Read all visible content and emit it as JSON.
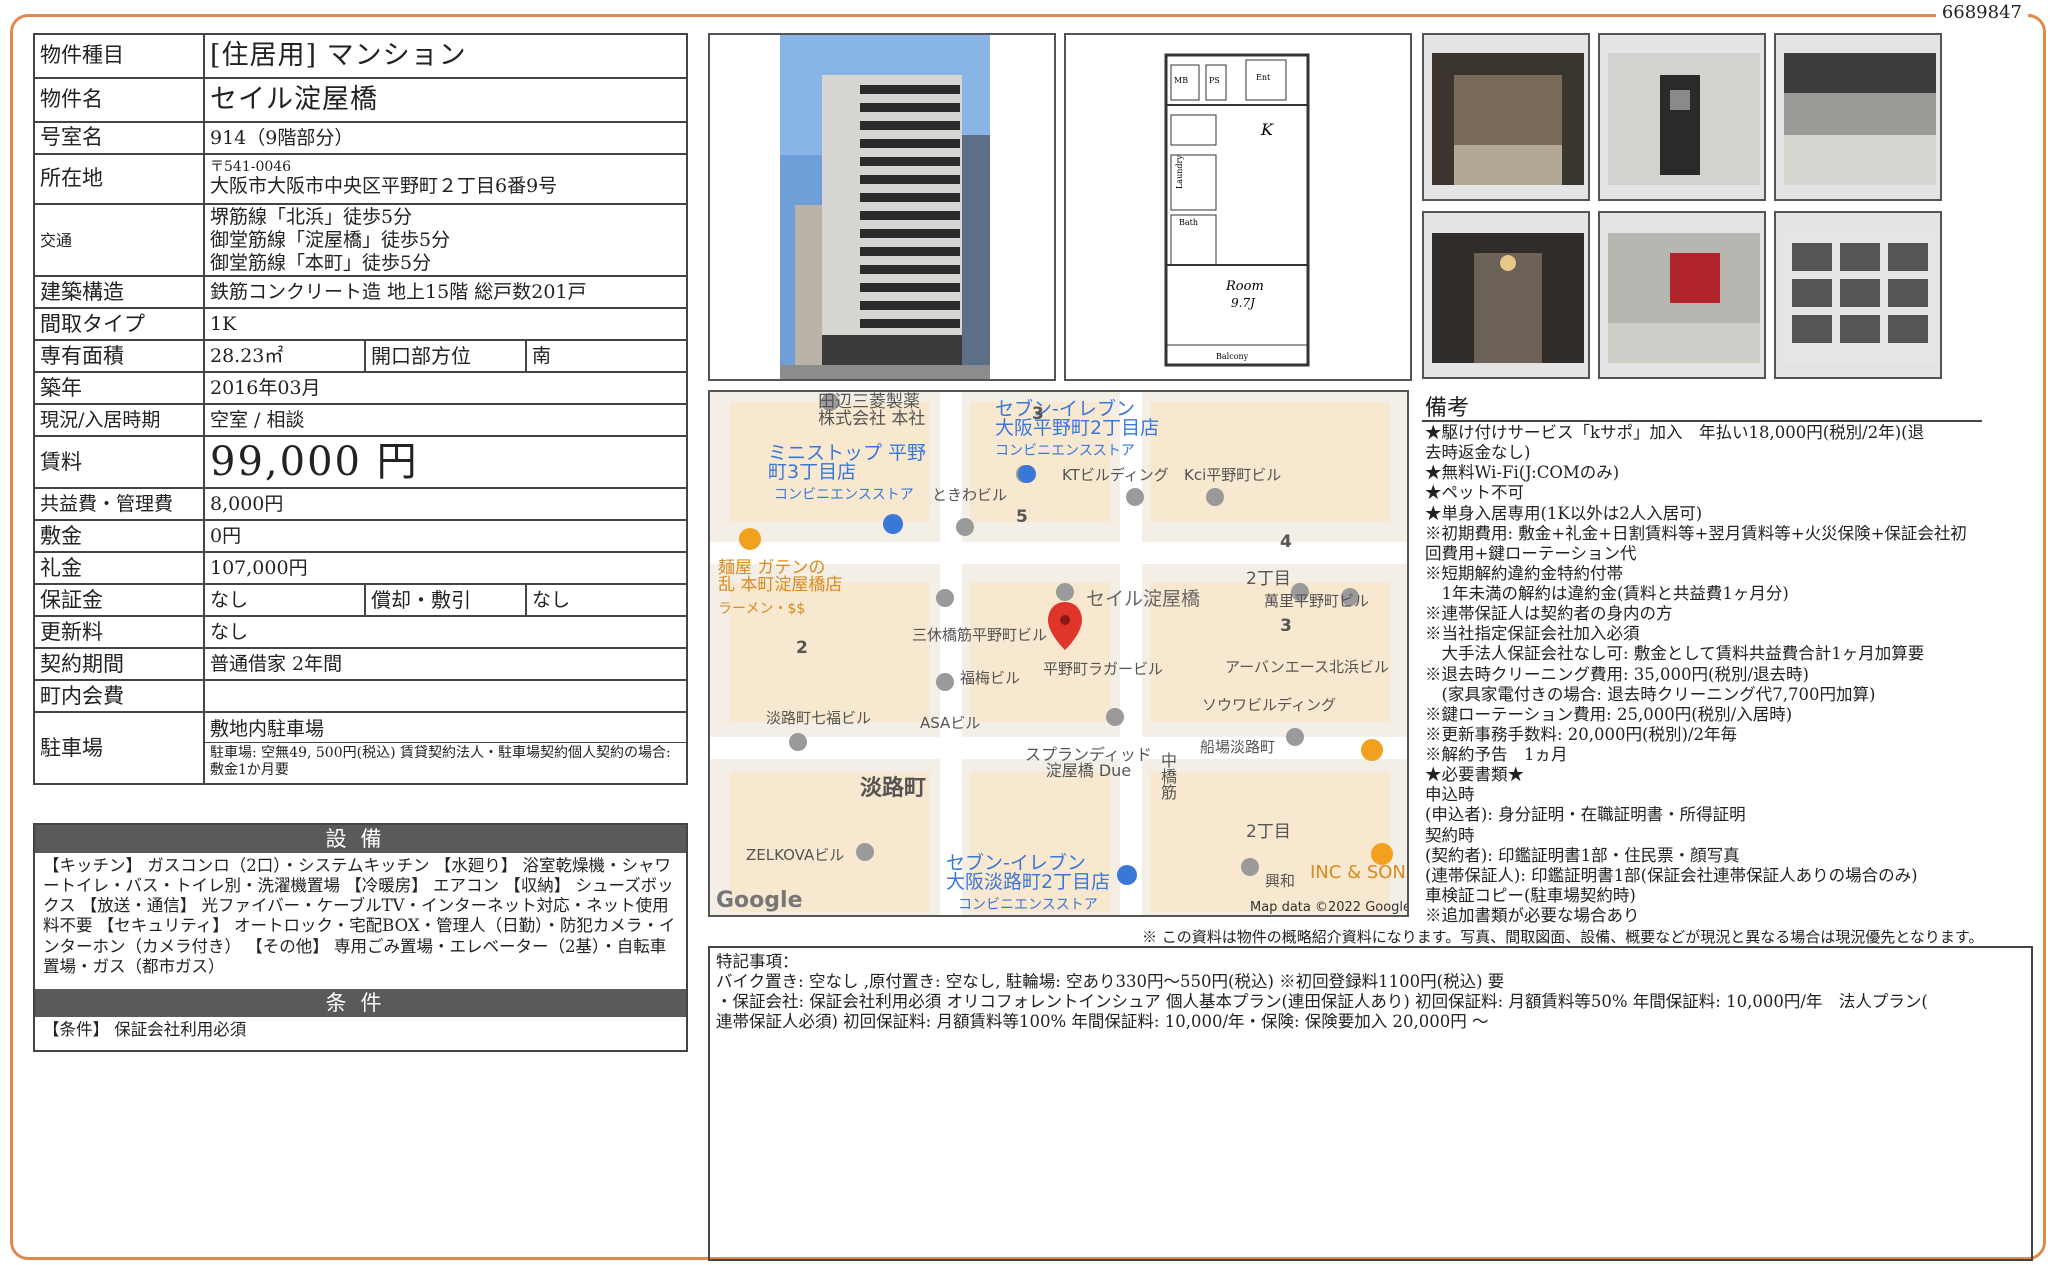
{
  "doc_id": "6689847",
  "property": {
    "type_label": "物件種目",
    "type_value": "[住居用] マンション",
    "name_label": "物件名",
    "name_value": "セイル淀屋橋",
    "room_label": "号室名",
    "room_value": "914（9階部分）",
    "address_label": "所在地",
    "address_zip": "〒541-0046",
    "address_value": "大阪市大阪市中央区平野町２丁目6番9号",
    "access_label": "交通",
    "access_lines": [
      "堺筋線「北浜」徒歩5分",
      "御堂筋線「淀屋橋」徒歩5分",
      "御堂筋線「本町」徒歩5分"
    ],
    "structure_label": "建築構造",
    "structure_value": "鉄筋コンクリート造 地上15階 総戸数201戸",
    "layout_label": "間取タイプ",
    "layout_value": "1K",
    "area_label": "専有面積",
    "area_value": "28.23㎡",
    "direction_label": "開口部方位",
    "direction_value": "南",
    "built_label": "築年",
    "built_value": "2016年03月",
    "status_label": "現況/入居時期",
    "status_value": "空室 / 相談",
    "rent_label": "賃料",
    "rent_value": "99,000 円",
    "fee_label": "共益費・管理費",
    "fee_value": "8,000円",
    "deposit_label": "敷金",
    "deposit_value": "0円",
    "key_money_label": "礼金",
    "key_money_value": "107,000円",
    "guarantee_label": "保証金",
    "guarantee_value": "なし",
    "amort_label": "償却・敷引",
    "amort_value": "なし",
    "renewal_label": "更新料",
    "renewal_value": "なし",
    "contract_label": "契約期間",
    "contract_value": "普通借家 2年間",
    "town_fee_label": "町内会費",
    "town_fee_value": "",
    "parking_label": "駐車場",
    "parking_value": "敷地内駐車場",
    "parking_note": "駐車場: 空無49, 500円(税込) 賃貸契約法人・駐車場契約個人契約の場合: 敷金1か月要"
  },
  "equipment": {
    "header": "設備",
    "text": "【キッチン】 ガスコンロ（2口）・システムキッチン 【水廻り】 浴室乾燥機・シャワートイレ・バス・トイレ別・洗濯機置場 【冷暖房】 エアコン 【収納】 シューズボックス 【放送・通信】 光ファイバー・ケーブルTV・インターネット対応・ネット使用料不要 【セキュリティ】 オートロック・宅配BOX・管理人（日勤）・防犯カメラ・インターホン（カメラ付き） 【その他】 専用ごみ置場・エレベーター（2基）・自転車置場・ガス（都市ガス）"
  },
  "conditions": {
    "header": "条件",
    "text": "【条件】 保証会社利用必須"
  },
  "floorplan": {
    "mb": "MB",
    "ps": "PS",
    "ent": "Ent",
    "k": "K",
    "laundry": "Laundry",
    "bath": "Bath",
    "room": "Room",
    "size": "9.7J",
    "balcony": "Balcony"
  },
  "map": {
    "labels": {
      "tanabe": "田辺三菱製薬\n株式会社 本社",
      "seven1": "セブン-イレブン\n大阪平野町2丁目店",
      "seven1_sub": "コンビニエンスストア",
      "ministop": "ミニストップ 平野\n町3丁目店",
      "ministop_sub": "コンビニエンスストア",
      "tokiwa": "ときわビル",
      "kt": "KTビルディング",
      "kci": "Kci平野町ビル",
      "ramen": "麺屋 ガテンの\n乱 本町淀屋橋店",
      "ramen_sub": "ラーメン・$$",
      "seil": "セイル淀屋橋",
      "chome2a": "2丁目",
      "manri": "萬里平野町ビル",
      "sankyu": "三休橋筋平野町ビル",
      "hirano_ragar": "平野町ラガービル",
      "an": "アーバンエース北浜ビル",
      "fukuume": "福梅ビル",
      "asa": "ASAビル",
      "awaji7": "淡路町七福ビル",
      "souwa": "ソウワビルディング",
      "splendid": "スプランディッド\n淀屋橋 Due",
      "funakoshi": "船場淡路町",
      "awajimachi": "淡路町",
      "naka": "中橋筋",
      "chome2b": "2丁目",
      "zelkova": "ZELKOVAビル",
      "seven2": "セブン-イレブン\n大阪淡路町2丁目店",
      "seven2_sub": "コンビニエンスストア",
      "kowa": "興和",
      "inc": "INC & SONS",
      "num3a": "3",
      "num5": "5",
      "num4": "4",
      "num3b": "3",
      "num2": "2",
      "google": "Google",
      "mapdata": "Map data ©2022 Google"
    }
  },
  "notes": {
    "title": "備考",
    "lines": [
      "★駆け付けサービス「kサポ」加入　年払い18,000円(税別/2年)(退",
      "去時返金なし)",
      "★無料Wi-Fi(J:COMのみ)",
      "★ペット不可",
      "★単身入居専用(1K以外は2人入居可)",
      "※初期費用: 敷金+礼金+日割賃料等+翌月賃料等+火災保険+保証会社初",
      "回費用+鍵ローテーション代",
      "※短期解約違約金特約付帯",
      "　1年未満の解約は違約金(賃料と共益費1ヶ月分)",
      "※連帯保証人は契約者の身内の方",
      "※当社指定保証会社加入必須",
      "　大手法人保証会社なし可: 敷金として賃料共益費合計1ヶ月加算要",
      "※退去時クリーニング費用: 35,000円(税別/退去時)",
      "　(家具家電付きの場合: 退去時クリーニング代7,700円加算)",
      "※鍵ローテーション費用: 25,000円(税別/入居時)",
      "※更新事務手数料: 20,000円(税別)/2年毎",
      "※解約予告　1ヵ月",
      "★必要書類★",
      "申込時",
      "(申込者): 身分証明・在職証明書・所得証明",
      "契約時",
      "(契約者): 印鑑証明書1部・住民票・顔写真",
      "(連帯保証人): 印鑑証明書1部(保証会社連帯保証人ありの場合のみ)",
      "車検証コピー(駐車場契約時)",
      "※追加書類が必要な場合あり"
    ]
  },
  "disclaimer": "※ この資料は物件の概略紹介資料になります。写真、間取図面、設備、概要などが現況と異なる場合は現況優先となります。",
  "special": {
    "lines": [
      "特記事項：",
      "バイク置き: 空なし ,原付置き: 空なし, 駐輪場: 空あり330円～550円(税込) ※初回登録料1100円(税込) 要",
      "・保証会社: 保証会社利用必須 オリコフォレントインシュア 個人基本プラン(連田保証人あり) 初回保証料: 月額賃料等50% 年間保証料: 10,000円/年　法人プラン(",
      "連帯保証人必須) 初回保証料: 月額賃料等100% 年間保証料: 10,000/年・保険: 保険要加入 20,000円 ～"
    ]
  }
}
